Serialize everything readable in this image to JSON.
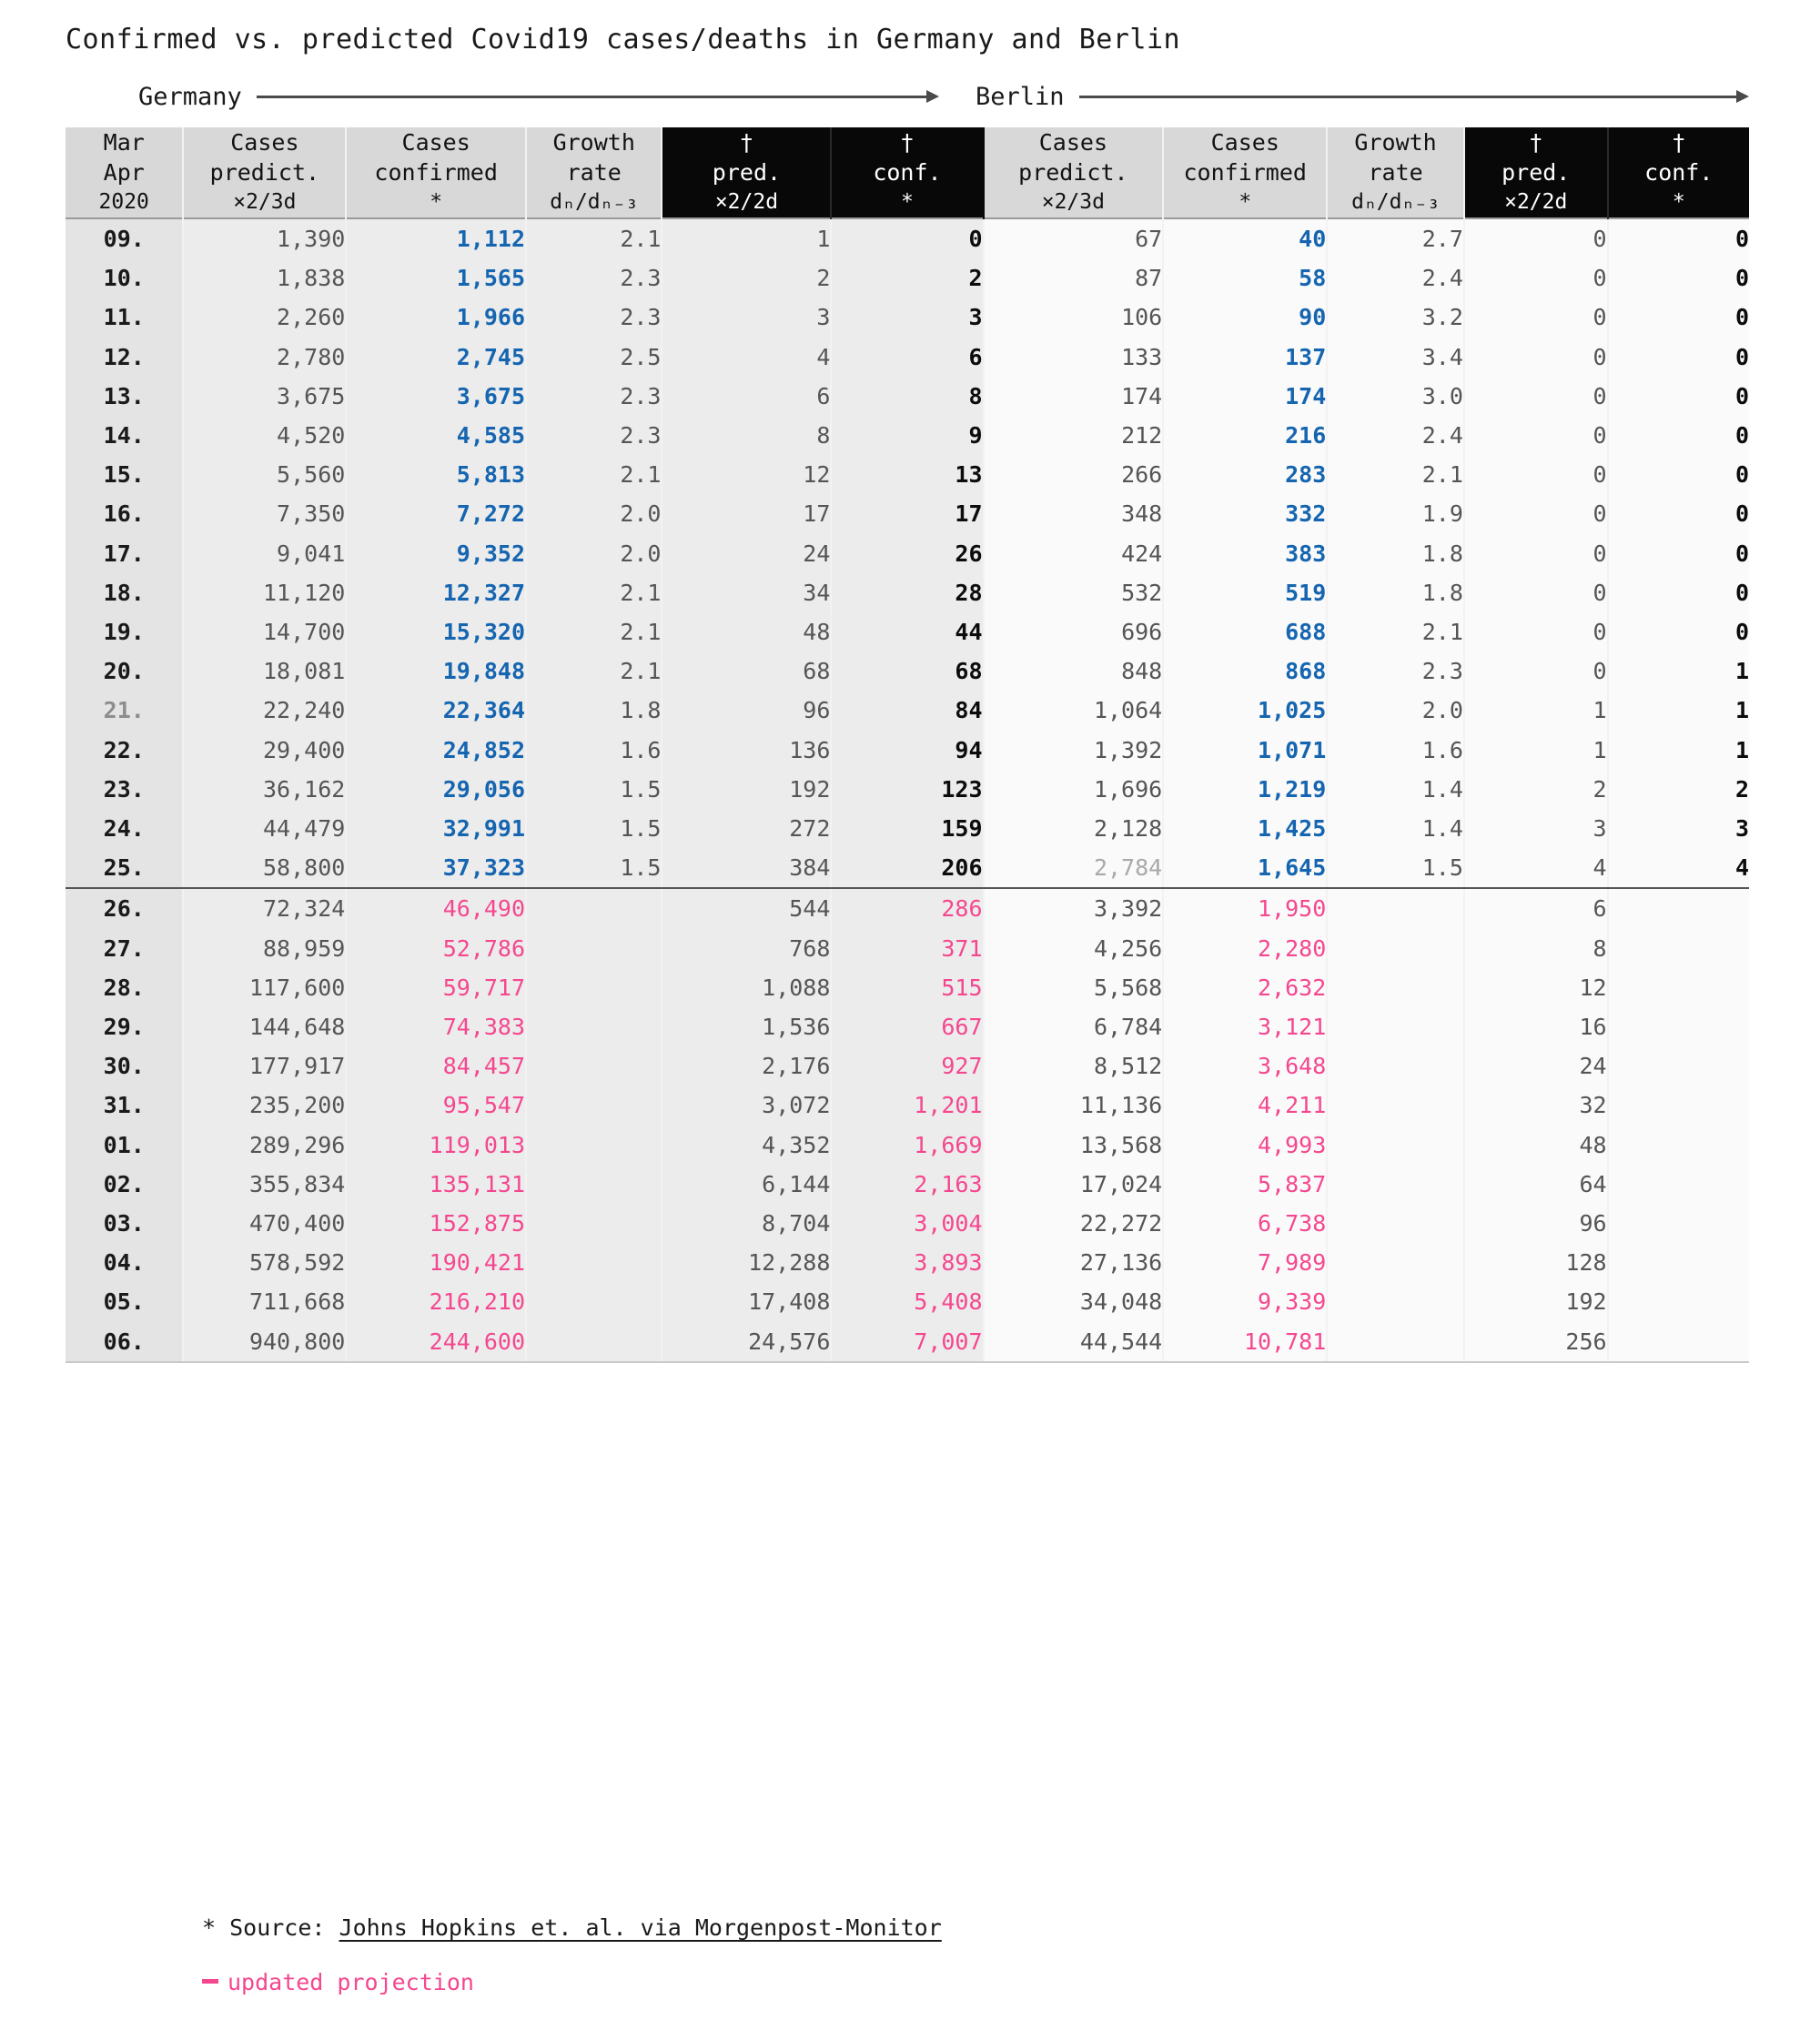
{
  "title": "Confirmed vs. predicted Covid19 cases/deaths in Germany and Berlin",
  "groups": [
    {
      "label": "Germany"
    },
    {
      "label": "Berlin"
    }
  ],
  "columns": [
    {
      "key": "date",
      "l1": "Mar",
      "l2": "Apr",
      "l3": "2020",
      "dark": false
    },
    {
      "key": "de_cp",
      "l1": "Cases",
      "l2": "predict.",
      "l3": "×2/3d",
      "dark": false
    },
    {
      "key": "de_cc",
      "l1": "Cases",
      "l2": "confirmed",
      "l3": "*",
      "dark": false
    },
    {
      "key": "de_gr",
      "l1": "Growth",
      "l2": "rate",
      "l3": "dₙ/dₙ₋₃",
      "dark": false
    },
    {
      "key": "de_dp",
      "l1": "†",
      "l2": "pred.",
      "l3": "×2/2d",
      "dark": true
    },
    {
      "key": "de_dc",
      "l1": "†",
      "l2": "conf.",
      "l3": "*",
      "dark": true
    },
    {
      "key": "be_cp",
      "l1": "Cases",
      "l2": "predict.",
      "l3": "×2/3d",
      "dark": false
    },
    {
      "key": "be_cc",
      "l1": "Cases",
      "l2": "confirmed",
      "l3": "*",
      "dark": false
    },
    {
      "key": "be_gr",
      "l1": "Growth",
      "l2": "rate",
      "l3": "dₙ/dₙ₋₃",
      "dark": false
    },
    {
      "key": "be_dp",
      "l1": "†",
      "l2": "pred.",
      "l3": "×2/2d",
      "dark": true
    },
    {
      "key": "be_dc",
      "l1": "†",
      "l2": "conf.",
      "l3": "*",
      "dark": true
    }
  ],
  "colors": {
    "confirmed_blue": "#1565b0",
    "projection_pink": "#f5478f",
    "header_gray": "#d8d8d8",
    "header_black": "#080808",
    "text_gray": "#555555"
  },
  "rows": [
    {
      "date": "09.",
      "de_cp": "1,390",
      "de_cc": "1,112",
      "de_gr": "2.1",
      "de_dp": "1",
      "de_dc": "0",
      "be_cp": "67",
      "be_cc": "40",
      "be_gr": "2.7",
      "be_dp": "0",
      "be_dc": "0",
      "proj": false
    },
    {
      "date": "10.",
      "de_cp": "1,838",
      "de_cc": "1,565",
      "de_gr": "2.3",
      "de_dp": "2",
      "de_dc": "2",
      "be_cp": "87",
      "be_cc": "58",
      "be_gr": "2.4",
      "be_dp": "0",
      "be_dc": "0",
      "proj": false
    },
    {
      "date": "11.",
      "de_cp": "2,260",
      "de_cc": "1,966",
      "de_gr": "2.3",
      "de_dp": "3",
      "de_dc": "3",
      "be_cp": "106",
      "be_cc": "90",
      "be_gr": "3.2",
      "be_dp": "0",
      "be_dc": "0",
      "proj": false
    },
    {
      "date": "12.",
      "de_cp": "2,780",
      "de_cc": "2,745",
      "de_gr": "2.5",
      "de_dp": "4",
      "de_dc": "6",
      "be_cp": "133",
      "be_cc": "137",
      "be_gr": "3.4",
      "be_dp": "0",
      "be_dc": "0",
      "proj": false
    },
    {
      "date": "13.",
      "de_cp": "3,675",
      "de_cc": "3,675",
      "de_gr": "2.3",
      "de_dp": "6",
      "de_dc": "8",
      "be_cp": "174",
      "be_cc": "174",
      "be_gr": "3.0",
      "be_dp": "0",
      "be_dc": "0",
      "proj": false
    },
    {
      "date": "14.",
      "de_cp": "4,520",
      "de_cc": "4,585",
      "de_gr": "2.3",
      "de_dp": "8",
      "de_dc": "9",
      "be_cp": "212",
      "be_cc": "216",
      "be_gr": "2.4",
      "be_dp": "0",
      "be_dc": "0",
      "proj": false
    },
    {
      "date": "15.",
      "de_cp": "5,560",
      "de_cc": "5,813",
      "de_gr": "2.1",
      "de_dp": "12",
      "de_dc": "13",
      "be_cp": "266",
      "be_cc": "283",
      "be_gr": "2.1",
      "be_dp": "0",
      "be_dc": "0",
      "proj": false
    },
    {
      "date": "16.",
      "de_cp": "7,350",
      "de_cc": "7,272",
      "de_gr": "2.0",
      "de_dp": "17",
      "de_dc": "17",
      "be_cp": "348",
      "be_cc": "332",
      "be_gr": "1.9",
      "be_dp": "0",
      "be_dc": "0",
      "proj": false
    },
    {
      "date": "17.",
      "de_cp": "9,041",
      "de_cc": "9,352",
      "de_gr": "2.0",
      "de_dp": "24",
      "de_dc": "26",
      "be_cp": "424",
      "be_cc": "383",
      "be_gr": "1.8",
      "be_dp": "0",
      "be_dc": "0",
      "proj": false
    },
    {
      "date": "18.",
      "de_cp": "11,120",
      "de_cc": "12,327",
      "de_gr": "2.1",
      "de_dp": "34",
      "de_dc": "28",
      "be_cp": "532",
      "be_cc": "519",
      "be_gr": "1.8",
      "be_dp": "0",
      "be_dc": "0",
      "proj": false
    },
    {
      "date": "19.",
      "de_cp": "14,700",
      "de_cc": "15,320",
      "de_gr": "2.1",
      "de_dp": "48",
      "de_dc": "44",
      "be_cp": "696",
      "be_cc": "688",
      "be_gr": "2.1",
      "be_dp": "0",
      "be_dc": "0",
      "proj": false
    },
    {
      "date": "20.",
      "de_cp": "18,081",
      "de_cc": "19,848",
      "de_gr": "2.1",
      "de_dp": "68",
      "de_dc": "68",
      "be_cp": "848",
      "be_cc": "868",
      "be_gr": "2.3",
      "be_dp": "0",
      "be_dc": "1",
      "proj": false
    },
    {
      "date": "21.",
      "de_cp": "22,240",
      "de_cc": "22,364",
      "de_gr": "1.8",
      "de_dp": "96",
      "de_dc": "84",
      "be_cp": "1,064",
      "be_cc": "1,025",
      "be_gr": "2.0",
      "be_dp": "1",
      "be_dc": "1",
      "proj": false,
      "dimdate": true
    },
    {
      "date": "22.",
      "de_cp": "29,400",
      "de_cc": "24,852",
      "de_gr": "1.6",
      "de_dp": "136",
      "de_dc": "94",
      "be_cp": "1,392",
      "be_cc": "1,071",
      "be_gr": "1.6",
      "be_dp": "1",
      "be_dc": "1",
      "proj": false
    },
    {
      "date": "23.",
      "de_cp": "36,162",
      "de_cc": "29,056",
      "de_gr": "1.5",
      "de_dp": "192",
      "de_dc": "123",
      "be_cp": "1,696",
      "be_cc": "1,219",
      "be_gr": "1.4",
      "be_dp": "2",
      "be_dc": "2",
      "proj": false
    },
    {
      "date": "24.",
      "de_cp": "44,479",
      "de_cc": "32,991",
      "de_gr": "1.5",
      "de_dp": "272",
      "de_dc": "159",
      "be_cp": "2,128",
      "be_cc": "1,425",
      "be_gr": "1.4",
      "be_dp": "3",
      "be_dc": "3",
      "proj": false
    },
    {
      "date": "25.",
      "de_cp": "58,800",
      "de_cc": "37,323",
      "de_gr": "1.5",
      "de_dp": "384",
      "de_dc": "206",
      "be_cp": "2,784",
      "be_cc": "1,645",
      "be_gr": "1.5",
      "be_dp": "4",
      "be_dc": "4",
      "proj": false,
      "dimbecp": true,
      "sep": true
    },
    {
      "date": "26.",
      "de_cp": "72,324",
      "de_cc": "46,490",
      "de_gr": "",
      "de_dp": "544",
      "de_dc": "286",
      "be_cp": "3,392",
      "be_cc": "1,950",
      "be_gr": "",
      "be_dp": "6",
      "be_dc": "",
      "proj": true
    },
    {
      "date": "27.",
      "de_cp": "88,959",
      "de_cc": "52,786",
      "de_gr": "",
      "de_dp": "768",
      "de_dc": "371",
      "be_cp": "4,256",
      "be_cc": "2,280",
      "be_gr": "",
      "be_dp": "8",
      "be_dc": "",
      "proj": true
    },
    {
      "date": "28.",
      "de_cp": "117,600",
      "de_cc": "59,717",
      "de_gr": "",
      "de_dp": "1,088",
      "de_dc": "515",
      "be_cp": "5,568",
      "be_cc": "2,632",
      "be_gr": "",
      "be_dp": "12",
      "be_dc": "",
      "proj": true
    },
    {
      "date": "29.",
      "de_cp": "144,648",
      "de_cc": "74,383",
      "de_gr": "",
      "de_dp": "1,536",
      "de_dc": "667",
      "be_cp": "6,784",
      "be_cc": "3,121",
      "be_gr": "",
      "be_dp": "16",
      "be_dc": "",
      "proj": true
    },
    {
      "date": "30.",
      "de_cp": "177,917",
      "de_cc": "84,457",
      "de_gr": "",
      "de_dp": "2,176",
      "de_dc": "927",
      "be_cp": "8,512",
      "be_cc": "3,648",
      "be_gr": "",
      "be_dp": "24",
      "be_dc": "",
      "proj": true
    },
    {
      "date": "31.",
      "de_cp": "235,200",
      "de_cc": "95,547",
      "de_gr": "",
      "de_dp": "3,072",
      "de_dc": "1,201",
      "be_cp": "11,136",
      "be_cc": "4,211",
      "be_gr": "",
      "be_dp": "32",
      "be_dc": "",
      "proj": true
    },
    {
      "date": "01.",
      "de_cp": "289,296",
      "de_cc": "119,013",
      "de_gr": "",
      "de_dp": "4,352",
      "de_dc": "1,669",
      "be_cp": "13,568",
      "be_cc": "4,993",
      "be_gr": "",
      "be_dp": "48",
      "be_dc": "",
      "proj": true
    },
    {
      "date": "02.",
      "de_cp": "355,834",
      "de_cc": "135,131",
      "de_gr": "",
      "de_dp": "6,144",
      "de_dc": "2,163",
      "be_cp": "17,024",
      "be_cc": "5,837",
      "be_gr": "",
      "be_dp": "64",
      "be_dc": "",
      "proj": true
    },
    {
      "date": "03.",
      "de_cp": "470,400",
      "de_cc": "152,875",
      "de_gr": "",
      "de_dp": "8,704",
      "de_dc": "3,004",
      "be_cp": "22,272",
      "be_cc": "6,738",
      "be_gr": "",
      "be_dp": "96",
      "be_dc": "",
      "proj": true
    },
    {
      "date": "04.",
      "de_cp": "578,592",
      "de_cc": "190,421",
      "de_gr": "",
      "de_dp": "12,288",
      "de_dc": "3,893",
      "be_cp": "27,136",
      "be_cc": "7,989",
      "be_gr": "",
      "be_dp": "128",
      "be_dc": "",
      "proj": true
    },
    {
      "date": "05.",
      "de_cp": "711,668",
      "de_cc": "216,210",
      "de_gr": "",
      "de_dp": "17,408",
      "de_dc": "5,408",
      "be_cp": "34,048",
      "be_cc": "9,339",
      "be_gr": "",
      "be_dp": "192",
      "be_dc": "",
      "proj": true
    },
    {
      "date": "06.",
      "de_cp": "940,800",
      "de_cc": "244,600",
      "de_gr": "",
      "de_dp": "24,576",
      "de_dc": "7,007",
      "be_cp": "44,544",
      "be_cc": "10,781",
      "be_gr": "",
      "be_dp": "256",
      "be_dc": "",
      "proj": true,
      "last": true
    }
  ],
  "footnotes": {
    "source_prefix": "* Source: ",
    "source_link": "Johns Hopkins et. al. via Morgenpost-Monitor",
    "projection_label": "updated projection"
  }
}
